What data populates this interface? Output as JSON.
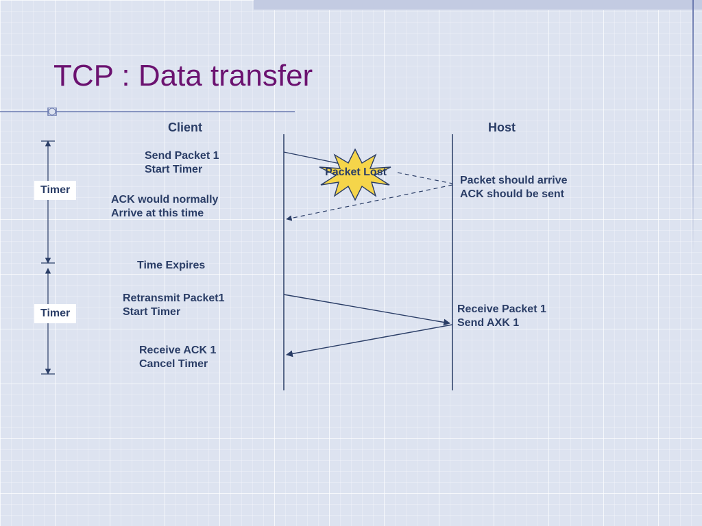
{
  "title": "TCP : Data transfer",
  "headers": {
    "client": "Client",
    "host": "Host"
  },
  "timers": {
    "one": "Timer",
    "two": "Timer"
  },
  "client_events": {
    "send": "Send Packet 1\nStart Timer",
    "ack_wait": "ACK would normally\nArrive at this time",
    "expire": "Time Expires",
    "retransmit": "Retransmit Packet1\nStart Timer",
    "receive_ack": "Receive ACK 1\nCancel Timer"
  },
  "host_events": {
    "expected": "Packet should arrive\nACK should be sent",
    "receive": "Receive Packet 1\nSend AXK 1"
  },
  "lost": "Packet Lost"
}
